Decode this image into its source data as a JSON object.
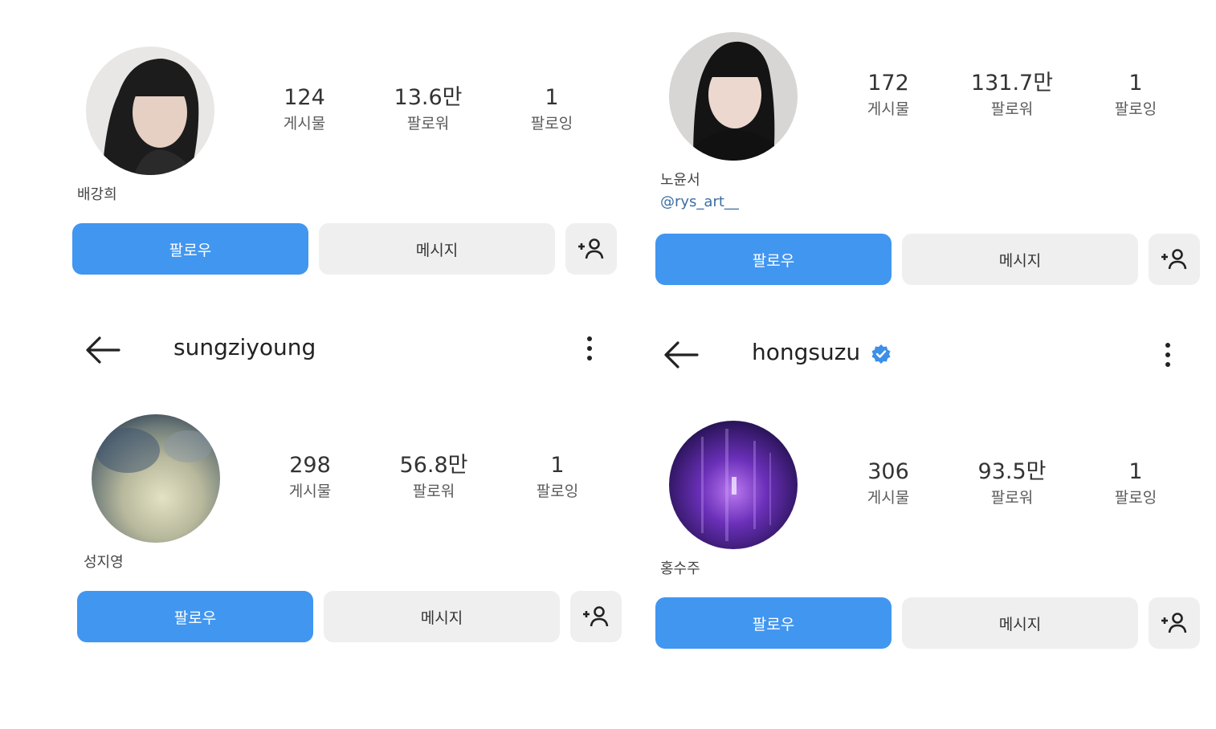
{
  "profiles": [
    {
      "username": "",
      "display_name": "배강희",
      "handle": "",
      "verified": false,
      "stats": [
        {
          "value": "124",
          "label": "게시물"
        },
        {
          "value": "13.6만",
          "label": "팔로워"
        },
        {
          "value": "1",
          "label": "팔로잉"
        }
      ]
    },
    {
      "username": "",
      "display_name": "노윤서",
      "handle": "@rys_art__",
      "verified": false,
      "stats": [
        {
          "value": "172",
          "label": "게시물"
        },
        {
          "value": "131.7만",
          "label": "팔로워"
        },
        {
          "value": "1",
          "label": "팔로잉"
        }
      ]
    },
    {
      "username": "sungziyoung",
      "display_name": "성지영",
      "handle": "",
      "verified": false,
      "stats": [
        {
          "value": "298",
          "label": "게시물"
        },
        {
          "value": "56.8만",
          "label": "팔로워"
        },
        {
          "value": "1",
          "label": "팔로잉"
        }
      ]
    },
    {
      "username": "hongsuzu",
      "display_name": "홍수주",
      "handle": "",
      "verified": true,
      "stats": [
        {
          "value": "306",
          "label": "게시물"
        },
        {
          "value": "93.5만",
          "label": "팔로워"
        },
        {
          "value": "1",
          "label": "팔로잉"
        }
      ]
    }
  ],
  "buttons": {
    "follow": "팔로우",
    "message": "메시지"
  },
  "icons": {
    "back": "arrow-left-icon",
    "more": "more-vertical-icon",
    "add_user": "add-user-icon",
    "verified": "verified-badge-icon"
  },
  "colors": {
    "follow_button": "#4196f0",
    "secondary_button": "#efefef",
    "verified_badge": "#3d8fe8",
    "handle_link": "#3b6da6"
  }
}
